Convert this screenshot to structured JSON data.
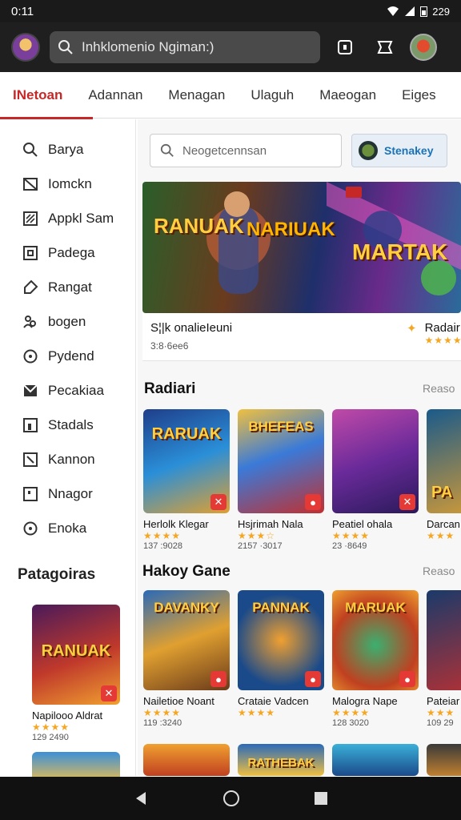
{
  "status": {
    "time": "0:11",
    "battery": "229"
  },
  "topbar": {
    "search_text": "Inhklomenio Ngiman:)"
  },
  "tabs": [
    {
      "label": "INetoan",
      "active": true
    },
    {
      "label": "Adannan"
    },
    {
      "label": "Menagan"
    },
    {
      "label": "Ulaguh"
    },
    {
      "label": "Maeogan"
    },
    {
      "label": "Eiges"
    }
  ],
  "sidebar": {
    "items": [
      {
        "label": "Barya",
        "icon": "search-icon"
      },
      {
        "label": "Iomckn",
        "icon": "mail-icon"
      },
      {
        "label": "Appkl Sam",
        "icon": "apps-icon"
      },
      {
        "label": "Padega",
        "icon": "square-icon"
      },
      {
        "label": "Rangat",
        "icon": "tag-icon"
      },
      {
        "label": "bogen",
        "icon": "people-icon"
      },
      {
        "label": "Pydend",
        "icon": "clock-icon"
      },
      {
        "label": "Pecakiaa",
        "icon": "inbox-icon"
      },
      {
        "label": "Stadals",
        "icon": "chart-icon"
      },
      {
        "label": "Kannon",
        "icon": "flag-icon"
      },
      {
        "label": "Nnagor",
        "icon": "frame-icon"
      },
      {
        "label": "Enoka",
        "icon": "info-icon"
      }
    ],
    "heading": "Patagoiras",
    "card": {
      "title": "RANUAK",
      "name": "Napilooo Aldrat",
      "stars": "★★★★",
      "meta": "129 2490"
    }
  },
  "main": {
    "search_placeholder": "Neogetcennsan",
    "store_label": "Stenakey",
    "hero": {
      "name": "S¦|k onalieIeuni",
      "sub": "3:8·6ee6",
      "right_label": "Radair",
      "right_stars": "★★★★",
      "art1": "RANUAK",
      "art2": "NARIUAK",
      "art3": "MARTAK"
    },
    "section1": {
      "title": "Radiari",
      "more": "Reaso"
    },
    "section1_cards": [
      {
        "art": "RARUAK",
        "name": "Herlolk Klegar",
        "stars": "★★★★",
        "meta": "137 :9028"
      },
      {
        "art": "BHEFEAS",
        "name": "Hsjrimah Nala",
        "stars": "★★★☆",
        "meta": "2157 ·3017"
      },
      {
        "art": "",
        "name": "Peatiel ohala",
        "stars": "★★★★",
        "meta": "23 ·8649"
      },
      {
        "art": "PA",
        "name": "Darcan",
        "stars": "★★★",
        "meta": ""
      }
    ],
    "section2": {
      "title": "Hakoy Gane",
      "more": "Reaso"
    },
    "section2_cards": [
      {
        "art": "DAVANKY",
        "name": "Nailetioe Noant",
        "stars": "★★★★",
        "meta": "119 :3240"
      },
      {
        "art": "PANNAK",
        "name": "Crataie Vadcen",
        "stars": "★★★★",
        "meta": ""
      },
      {
        "art": "MARUAK",
        "name": "Malogra Nape",
        "stars": "★★★★",
        "meta": "128 3020"
      },
      {
        "art": "",
        "name": "Pateiar",
        "stars": "★★★",
        "meta": "109 29"
      }
    ],
    "section3_art": "RATHEBAK"
  },
  "colors": {
    "accent": "#c62828",
    "star": "#f5a623"
  }
}
